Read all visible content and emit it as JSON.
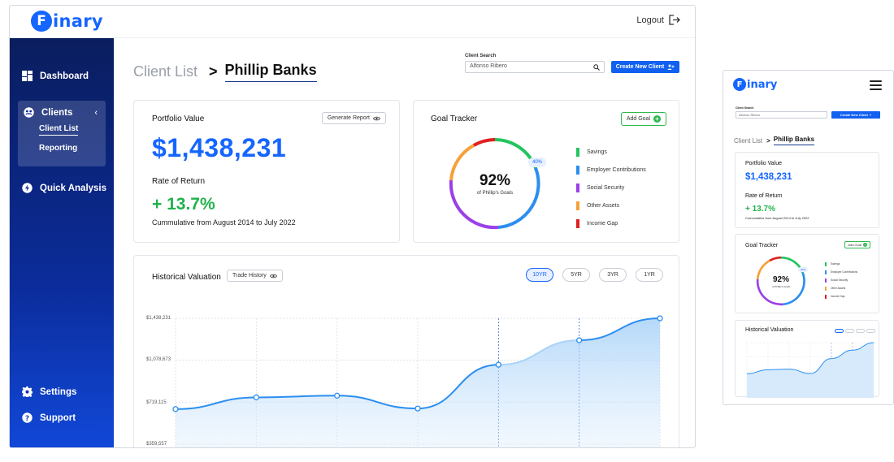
{
  "brand": {
    "letter": "F",
    "rest": "inary",
    "color": "#1565ff"
  },
  "topbar": {
    "logout_label": "Logout"
  },
  "sidebar": {
    "dashboard": "Dashboard",
    "clients": "Clients",
    "client_list": "Client List",
    "reporting": "Reporting",
    "quick_analysis": "Quick Analysis",
    "settings": "Settings",
    "support": "Support"
  },
  "breadcrumb": {
    "parent": "Client List",
    "separator": ">",
    "current": "Phillip Banks"
  },
  "search": {
    "label": "Client Search",
    "value": "Alfonso Ribero"
  },
  "create_button": "Create New Client",
  "portfolio": {
    "title": "Portfolio Value",
    "generate_label": "Generate Report",
    "value": "$1,438,231",
    "ror_title": "Rate of Return",
    "ror_value": "+ 13.7%",
    "ror_note": "Cummulative from August 2014 to July 2022"
  },
  "goal_tracker": {
    "title": "Goal Tracker",
    "add_label": "Add Goal",
    "percent": "92%",
    "subtitle": "of Phillip's Goals",
    "badge": "40%",
    "legend": [
      {
        "label": "Savings",
        "color": "#22c55e"
      },
      {
        "label": "Employer Contributions",
        "color": "#2b8ef0"
      },
      {
        "label": "Social Security",
        "color": "#9b40e8"
      },
      {
        "label": "Other Assets",
        "color": "#f5a13a"
      },
      {
        "label": "Income Gap",
        "color": "#e02020"
      }
    ]
  },
  "historical": {
    "title": "Historical Valuation",
    "trade_label": "Trade History",
    "ranges": [
      "10YR",
      "5YR",
      "3YR",
      "1YR"
    ],
    "active_range": "10YR"
  },
  "chart_data": {
    "type": "area",
    "title": "Historical Valuation",
    "y_ticks": [
      "$1,438,231",
      "$1,078,673",
      "$719,115",
      "$359,557"
    ],
    "ylim": [
      359557,
      1438231
    ],
    "values": [
      660000,
      760000,
      775000,
      665000,
      1040000,
      1250000,
      1438231
    ],
    "grid": true,
    "series": [
      {
        "values": [
          660000,
          760000,
          775000,
          665000,
          1040000,
          1250000,
          1438231
        ]
      }
    ]
  },
  "mobile": {
    "menu_icon": "hamburger-icon"
  }
}
